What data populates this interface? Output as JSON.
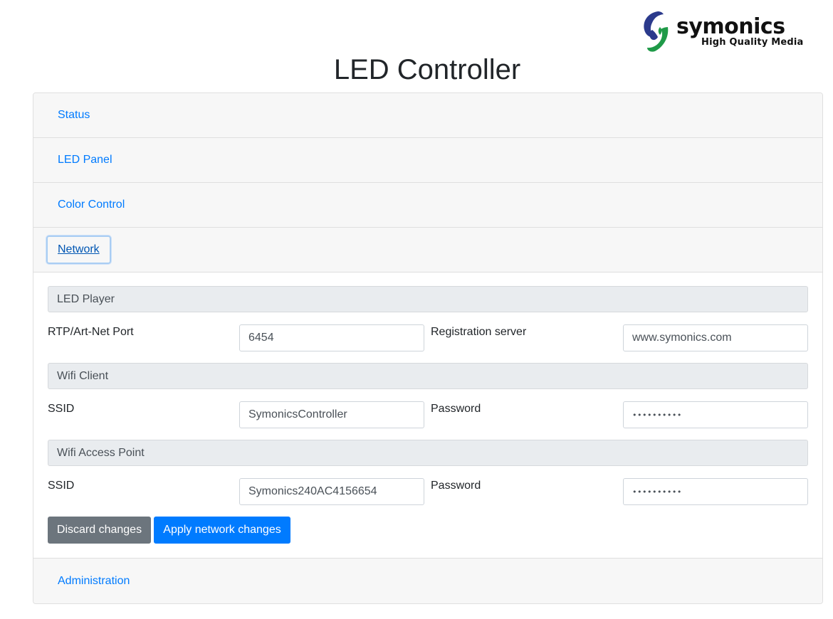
{
  "brand": {
    "name": "symonics",
    "tagline": "High Quality Media",
    "colors": {
      "blue": "#2b3a8c",
      "green": "#1f9a48"
    }
  },
  "page_title": "LED Controller",
  "accordion": {
    "status": "Status",
    "led_panel": "LED Panel",
    "color_control": "Color Control",
    "network": "Network",
    "administration": "Administration"
  },
  "network": {
    "led_player": {
      "title": "LED Player",
      "port_label": "RTP/Art-Net Port",
      "port_value": "6454",
      "server_label": "Registration server",
      "server_value": "www.symonics.com"
    },
    "wifi_client": {
      "title": "Wifi Client",
      "ssid_label": "SSID",
      "ssid_value": "SymonicsController",
      "password_label": "Password",
      "password_value": "••••••••••"
    },
    "wifi_ap": {
      "title": "Wifi Access Point",
      "ssid_label": "SSID",
      "ssid_value": "Symonics240AC4156654",
      "password_label": "Password",
      "password_value": "••••••••••"
    },
    "buttons": {
      "discard": "Discard changes",
      "apply": "Apply network changes"
    }
  },
  "colors": {
    "primary": "#007bff",
    "secondary": "#6c757d",
    "header_bg": "#f7f7f7",
    "section_bg": "#e9ecef"
  }
}
